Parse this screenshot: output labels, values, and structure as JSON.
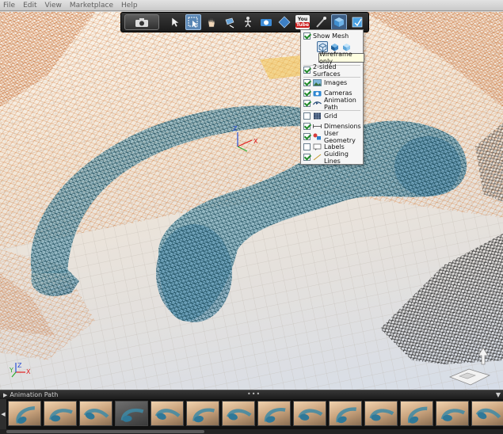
{
  "menu": {
    "items": [
      "File",
      "Edit",
      "View",
      "Marketplace",
      "Help"
    ]
  },
  "toolbar": {
    "buttons": [
      {
        "name": "camera-icon"
      },
      {
        "name": "select-pointer-icon"
      },
      {
        "name": "select-box-icon"
      },
      {
        "name": "pan-hand-icon"
      },
      {
        "name": "rotate-icon"
      },
      {
        "name": "walk-icon"
      },
      {
        "name": "photo-camera-icon"
      },
      {
        "name": "measure-icon"
      },
      {
        "name": "youtube-icon"
      },
      {
        "name": "brush-icon"
      },
      {
        "name": "view-options-icon"
      },
      {
        "name": "export-icon"
      }
    ],
    "youtube_you": "You",
    "youtube_tube": "Tube"
  },
  "view_menu": {
    "show_mesh": "Show Mesh",
    "tooltip": "Wireframe only",
    "items": [
      {
        "label": "2-sided Surfaces",
        "checked": true
      },
      {
        "label": "Images",
        "checked": true
      },
      {
        "label": "Cameras",
        "checked": true
      },
      {
        "label": "Animation Path",
        "checked": true
      },
      {
        "label": "Grid",
        "checked": false
      },
      {
        "label": "Dimensions",
        "checked": true
      },
      {
        "label": "User Geometry",
        "checked": true
      },
      {
        "label": "Labels",
        "checked": false
      },
      {
        "label": "Guiding Lines",
        "checked": true
      }
    ]
  },
  "axes": {
    "x": "X",
    "y": "Y",
    "z": "Z"
  },
  "panel": {
    "title": "Animation Path",
    "thumbnail_count": 14
  },
  "colors": {
    "accent": "#5a87b5",
    "mesh_teal": "#2d6e86",
    "mesh_orange": "#d98a4f",
    "check_green": "#1f8a2a"
  }
}
